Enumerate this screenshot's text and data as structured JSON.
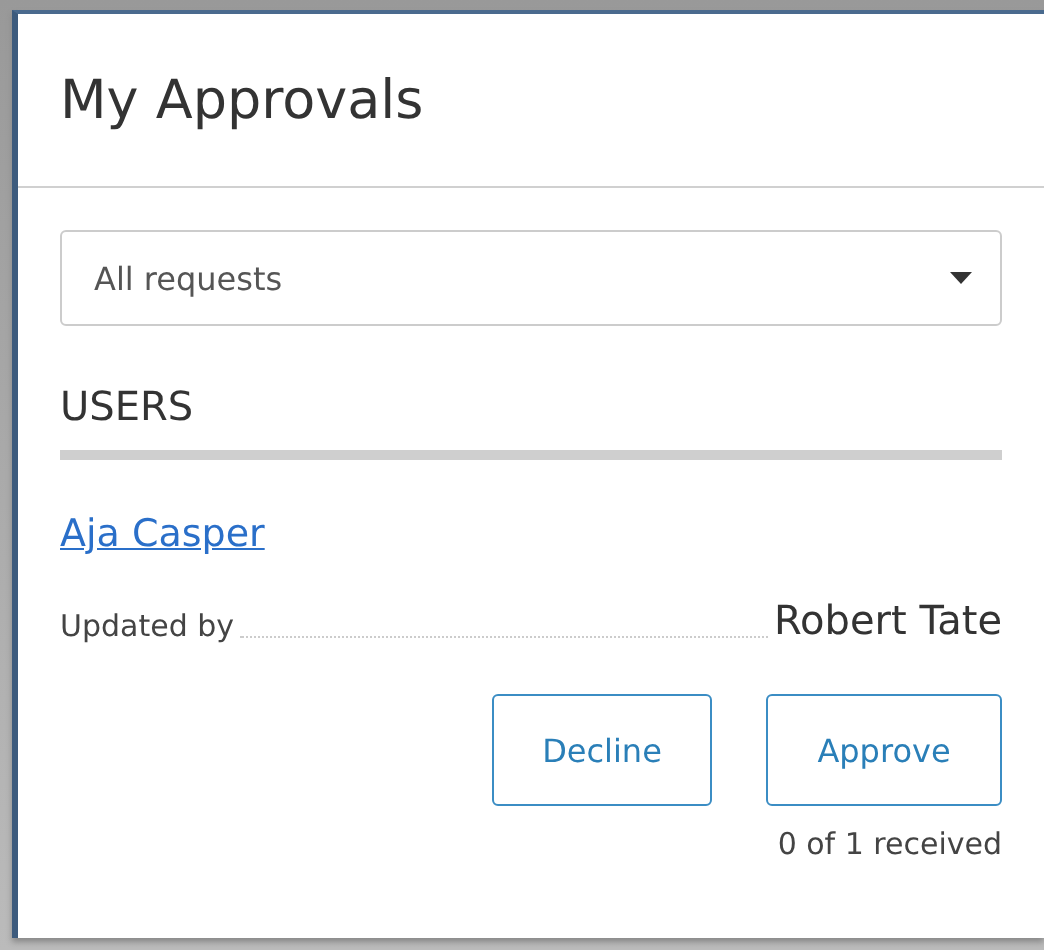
{
  "window": {
    "title": "My Approvals"
  },
  "filter": {
    "value": "All requests"
  },
  "section": {
    "heading": "USERS"
  },
  "item": {
    "name": "Aja Casper",
    "field_label": "Updated by",
    "field_value": "Robert Tate"
  },
  "buttons": [
    {
      "label": "Decline"
    },
    {
      "label": "Approve"
    }
  ],
  "status": "0 of 1 received"
}
